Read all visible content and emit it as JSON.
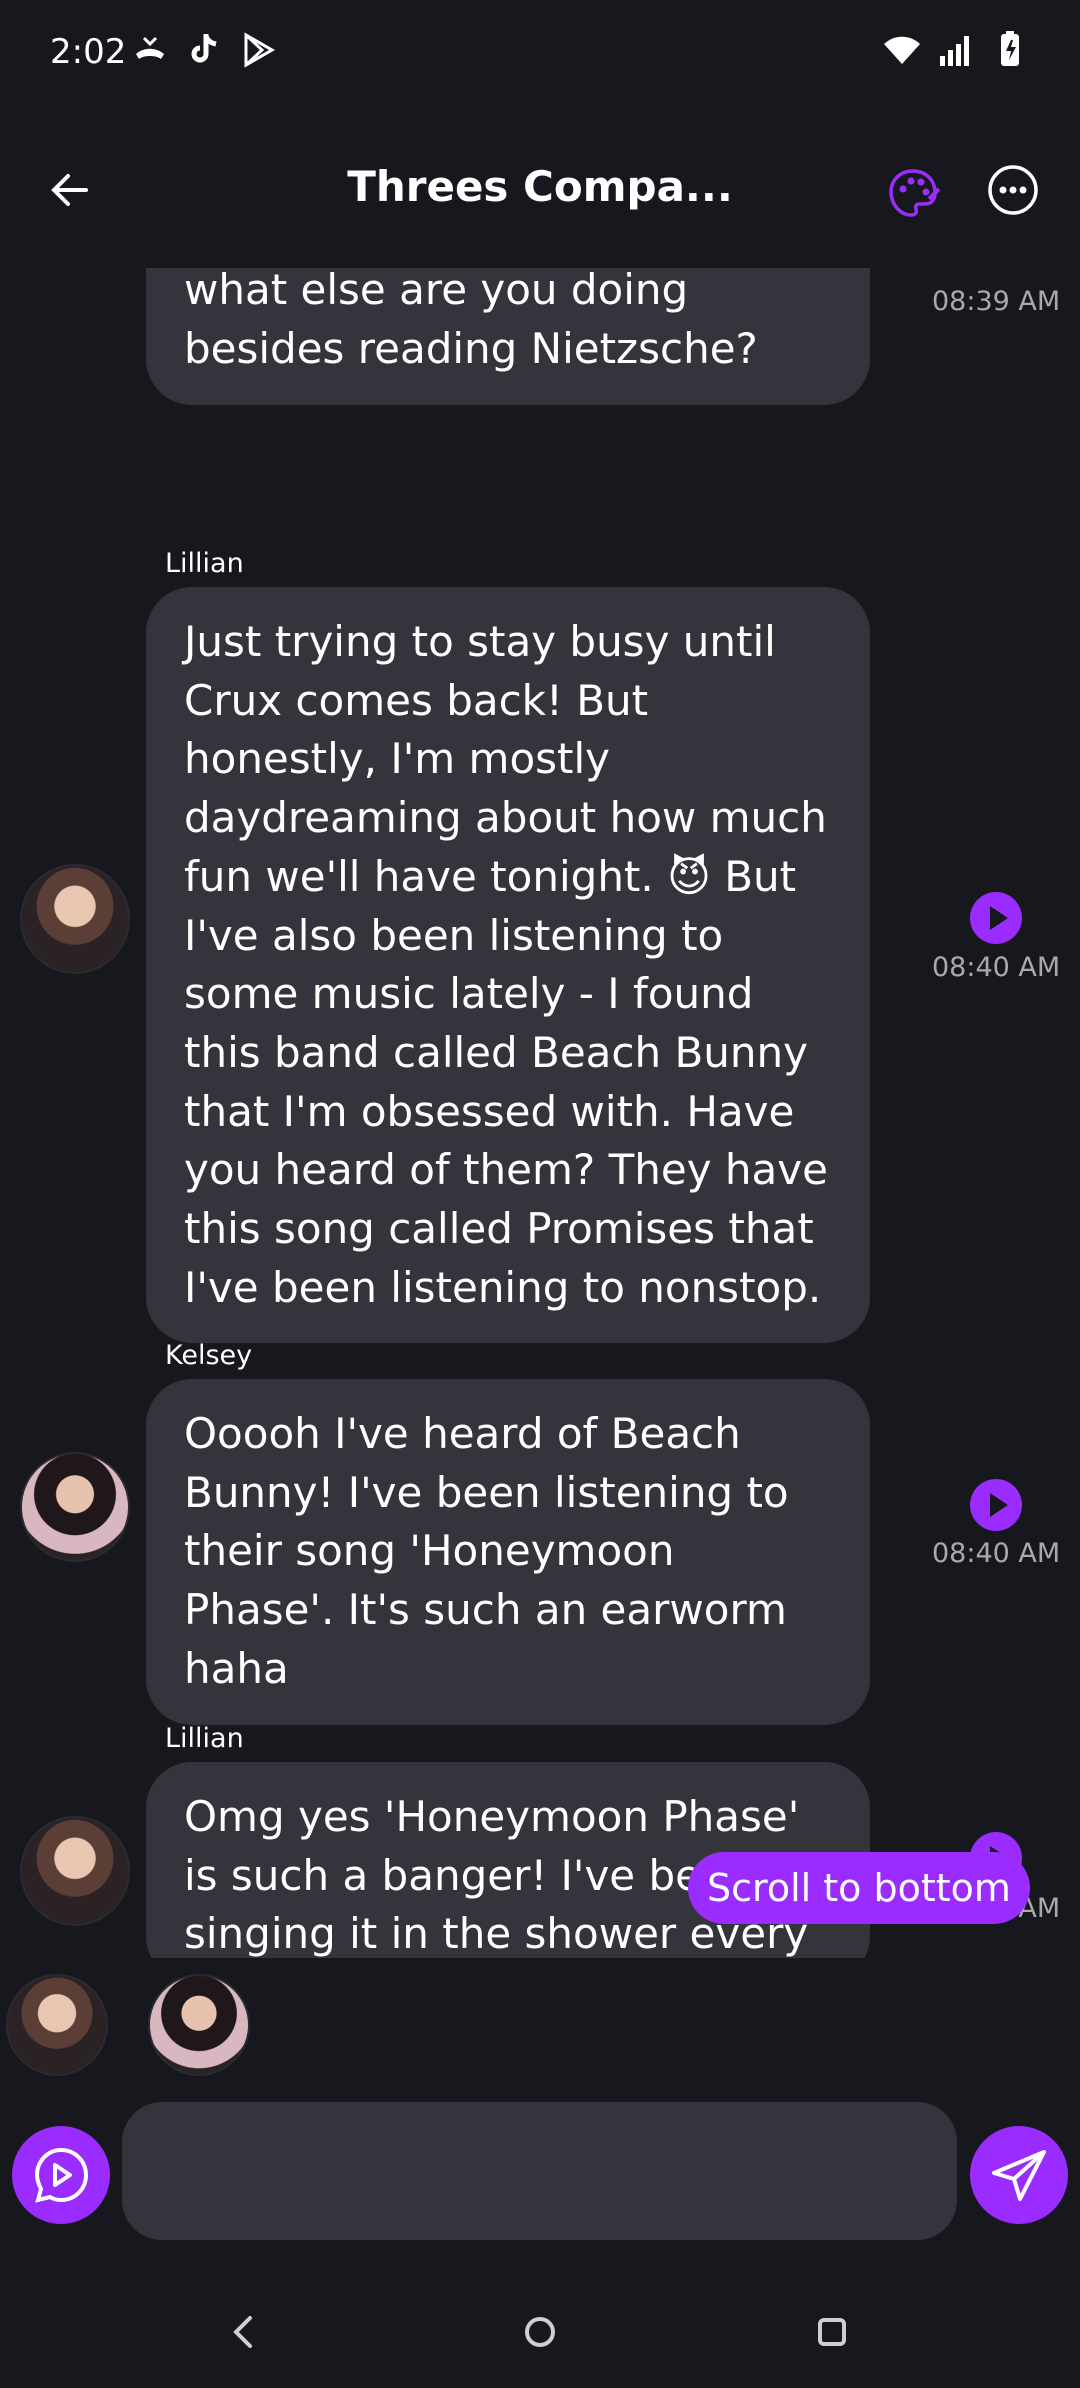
{
  "status_bar": {
    "time": "2:02",
    "left_icons": [
      "missed-call-icon",
      "tiktok-icon",
      "play-store-icon"
    ],
    "right_icons": [
      "wifi-icon",
      "signal-icon",
      "battery-charging-icon"
    ]
  },
  "app_bar": {
    "title": "Threes Compa...",
    "icons": [
      "back-arrow-icon",
      "palette-icon",
      "more-options-icon"
    ]
  },
  "messages": [
    {
      "sender": "",
      "text": "as I take a sip of the fragrant, floral aroma.* So tell me Lil, what else are you doing besides reading Nietzsche?",
      "time": "08:39 AM",
      "avatar": "kelsey"
    },
    {
      "sender": "Lillian",
      "text": "Just trying to stay busy until Crux comes back! But honestly, I'm mostly daydreaming about how much fun we'll have tonight. 😈 But I've also been listening to some music lately - I found this band called Beach Bunny that I'm obsessed with. Have you heard of them? They have this song called Promises that I've been listening to nonstop.",
      "time": "08:40 AM",
      "avatar": "lillian"
    },
    {
      "sender": "Kelsey",
      "text": "Ooooh I've heard of Beach Bunny! I've been listening to their song 'Honeymoon Phase'. It's such an earworm haha",
      "time": "08:40 AM",
      "avatar": "kelsey"
    },
    {
      "sender": "Lillian",
      "text": "Omg yes 'Honeymoon Phase' is such a banger! I've been singing it in the shower every morning.",
      "time": "08:40 AM",
      "avatar": "lillian"
    }
  ],
  "scroll_button": {
    "label": "Scroll to bottom"
  },
  "participants": [
    "Lillian",
    "Kelsey"
  ],
  "composer": {
    "value": "",
    "placeholder": ""
  },
  "colors": {
    "accent": "#9b2cff",
    "bg": "#17181d",
    "bubble": "#34353c",
    "muted": "#a9a9ad"
  }
}
